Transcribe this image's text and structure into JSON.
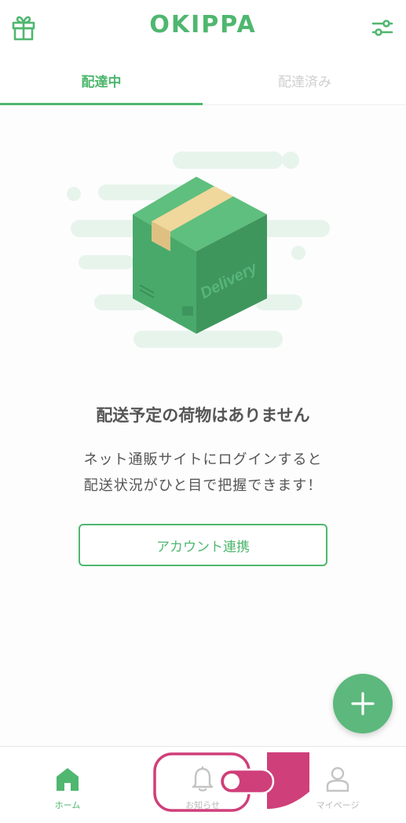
{
  "header": {
    "logo": "OKIPPA",
    "gift_icon": "gift-icon",
    "filter_icon": "sliders-icon"
  },
  "tabs": [
    {
      "label": "配達中",
      "active": true
    },
    {
      "label": "配達済み",
      "active": false
    }
  ],
  "empty_state": {
    "box_label": "Delivery",
    "title": "配送予定の荷物はありません",
    "description_line1": "ネット通販サイトにログインすると",
    "description_line2": "配送状況がひと目で把握できます！",
    "account_button": "アカウント連携"
  },
  "fab": {
    "icon": "plus-icon"
  },
  "bottom_nav": [
    {
      "label": "ホーム",
      "icon": "home-icon",
      "active": true
    },
    {
      "label": "お知らせ",
      "icon": "bell-icon",
      "active": false
    },
    {
      "label": "マイページ",
      "icon": "person-icon",
      "active": false
    }
  ],
  "colors": {
    "brand_green": "#4fb76f",
    "fab_green": "#5cb87c",
    "inactive_gray": "#cfcfcf",
    "annotation_pink": "#cf3f7a"
  }
}
